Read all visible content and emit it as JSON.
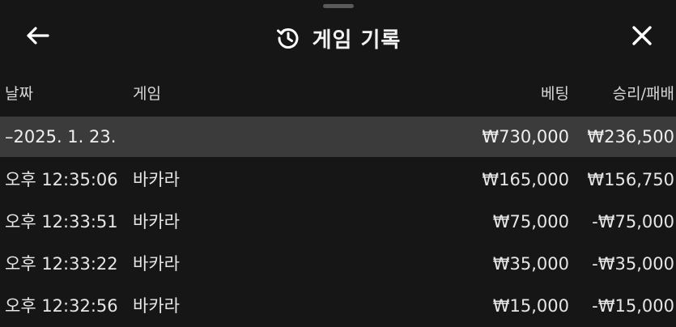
{
  "header": {
    "title": "게임 기록",
    "back_icon": "arrow-left-icon",
    "history_icon": "history-icon",
    "close_icon": "close-icon"
  },
  "columns": {
    "date": "날짜",
    "game": "게임",
    "bet": "베팅",
    "result": "승리/패배"
  },
  "group": {
    "toggle": "–",
    "date": "2025. 1. 23.",
    "bet_total": "₩730,000",
    "result_total": "₩236,500"
  },
  "rows": [
    {
      "time": "오후 12:35:06",
      "game": "바카라",
      "bet": "₩165,000",
      "result": "₩156,750"
    },
    {
      "time": "오후 12:33:51",
      "game": "바카라",
      "bet": "₩75,000",
      "result": "-₩75,000"
    },
    {
      "time": "오후 12:33:22",
      "game": "바카라",
      "bet": "₩35,000",
      "result": "-₩35,000"
    },
    {
      "time": "오후 12:32:56",
      "game": "바카라",
      "bet": "₩15,000",
      "result": "-₩15,000"
    }
  ]
}
